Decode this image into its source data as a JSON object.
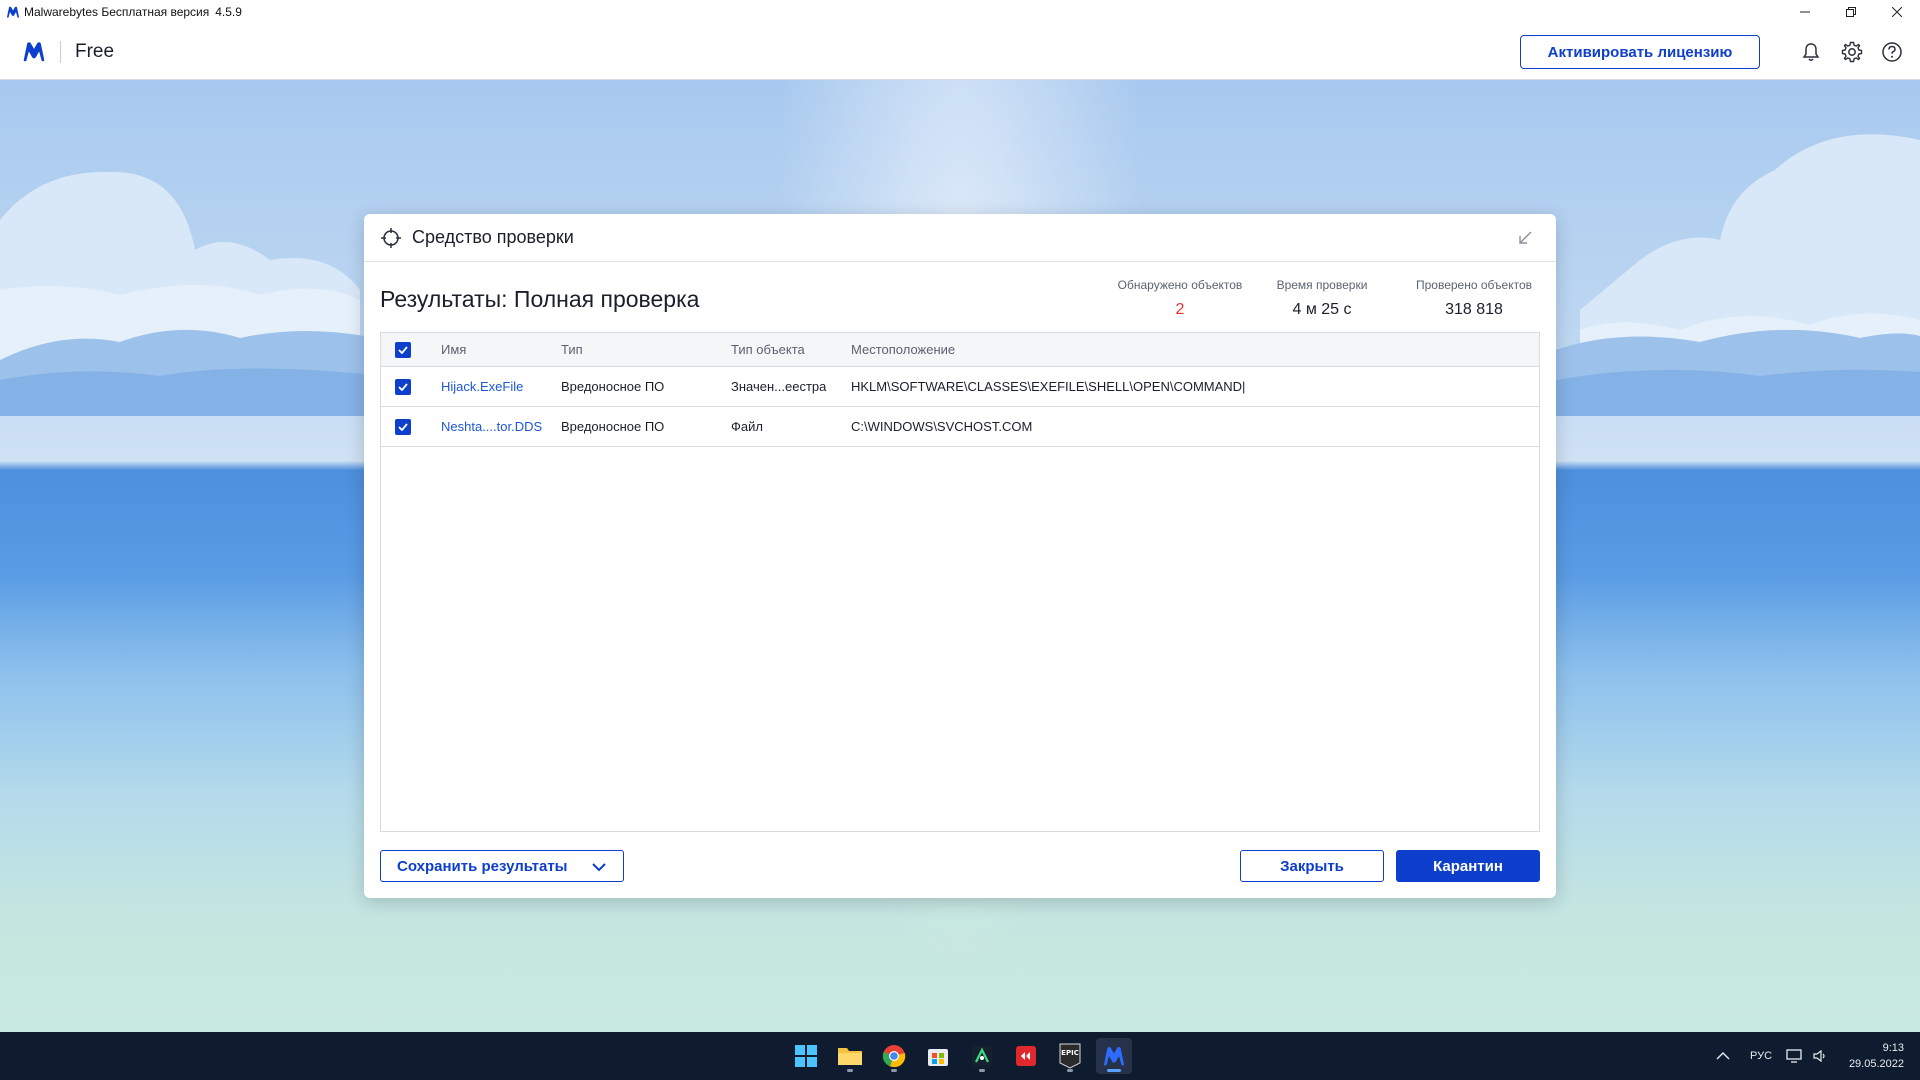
{
  "window": {
    "title": "Malwarebytes Бесплатная версия",
    "version": "4.5.9"
  },
  "header": {
    "edition": "Free",
    "activate_label": "Активировать лицензию",
    "icons": [
      "bell-icon",
      "gear-icon",
      "help-icon"
    ]
  },
  "dialog": {
    "title": "Средство проверки",
    "results_title": "Результаты: Полная проверка",
    "stats": [
      {
        "label": "Обнаружено объектов",
        "value": "2"
      },
      {
        "label": "Время проверки",
        "value": "4 м 25 с"
      },
      {
        "label": "Проверено объектов",
        "value": "318 818"
      }
    ],
    "columns": [
      "Имя",
      "Тип",
      "Тип объекта",
      "Местоположение"
    ],
    "rows": [
      {
        "checked": true,
        "name": "Hijack.ExeFile",
        "type": "Вредоносное ПО",
        "object_type": "Значен...еестра",
        "location": "HKLM\\SOFTWARE\\CLASSES\\EXEFILE\\SHELL\\OPEN\\COMMAND|"
      },
      {
        "checked": true,
        "name": "Neshta....tor.DDS",
        "type": "Вредоносное ПО",
        "object_type": "Файл",
        "location": "C:\\WINDOWS\\SVCHOST.COM"
      }
    ],
    "save_label": "Сохранить результаты",
    "close_label": "Закрыть",
    "quarantine_label": "Карантин"
  },
  "taskbar": {
    "apps": [
      "windows-start",
      "file-explorer",
      "chrome",
      "microsoft-store",
      "app-green",
      "app-red",
      "epic-games",
      "malwarebytes"
    ],
    "tray_language": "РУС",
    "time": "9:13",
    "date": "29.05.2022"
  },
  "colors": {
    "accent": "#0d3ecc",
    "danger": "#e33131",
    "link": "#1f56d6"
  }
}
